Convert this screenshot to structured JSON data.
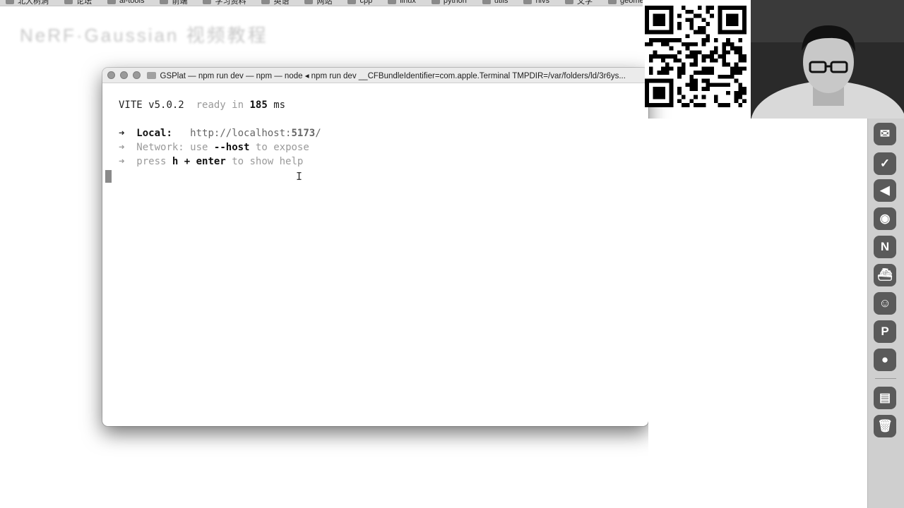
{
  "bookmarks": [
    {
      "label": "北大树洞",
      "icon": "folder-icon"
    },
    {
      "label": "论坛",
      "icon": "folder-icon"
    },
    {
      "label": "ai-tools",
      "icon": "folder-icon"
    },
    {
      "label": "前端",
      "icon": "folder-icon"
    },
    {
      "label": "学习资料",
      "icon": "folder-icon"
    },
    {
      "label": "英语",
      "icon": "folder-icon"
    },
    {
      "label": "网站",
      "icon": "folder-icon"
    },
    {
      "label": "cpp",
      "icon": "folder-icon"
    },
    {
      "label": "linux",
      "icon": "folder-icon"
    },
    {
      "label": "python",
      "icon": "folder-icon"
    },
    {
      "label": "utils",
      "icon": "folder-icon"
    },
    {
      "label": "nlvs",
      "icon": "folder-icon"
    },
    {
      "label": "文学",
      "icon": "folder-icon"
    },
    {
      "label": "geometry",
      "icon": "folder-icon"
    }
  ],
  "page": {
    "title": "NeRF·Gaussian 视频教程"
  },
  "terminal": {
    "title": "GSPlat — npm run dev — npm — node ◂ npm run dev __CFBundleIdentifier=com.apple.Terminal TMPDIR=/var/folders/ld/3r6ys...",
    "vite_name": "VITE",
    "vite_version": "v5.0.2",
    "ready_in": "ready in",
    "ready_ms": "185",
    "ms": "ms",
    "arrow": "➜",
    "local_label": "Local:",
    "local_url_prefix": "http://localhost:",
    "local_port": "5173",
    "local_url_suffix": "/",
    "network_label": "Network:",
    "network_use": "use",
    "network_flag": "--host",
    "network_tail": "to expose",
    "press": "press",
    "key_h": "h + enter",
    "help_tail": "to show help"
  },
  "dock": [
    {
      "name": "wechat-icon",
      "glyph": "✉"
    },
    {
      "name": "ticktick-icon",
      "glyph": "✓"
    },
    {
      "name": "vscode-icon",
      "glyph": "◀"
    },
    {
      "name": "edge-icon",
      "glyph": "◉"
    },
    {
      "name": "notion-icon",
      "glyph": "N"
    },
    {
      "name": "docker-icon",
      "glyph": "⛴"
    },
    {
      "name": "discord-icon",
      "glyph": "☺"
    },
    {
      "name": "powerpoint-icon",
      "glyph": "P"
    },
    {
      "name": "obs-icon",
      "glyph": "●"
    },
    {
      "name": "downloads-icon",
      "glyph": "▤"
    },
    {
      "name": "trash-icon",
      "glyph": "🗑"
    }
  ],
  "colors": {
    "terminal_bg": "#ffffff",
    "dim_text": "#9a9a9a",
    "dock_bg": "#cfcfcf"
  }
}
